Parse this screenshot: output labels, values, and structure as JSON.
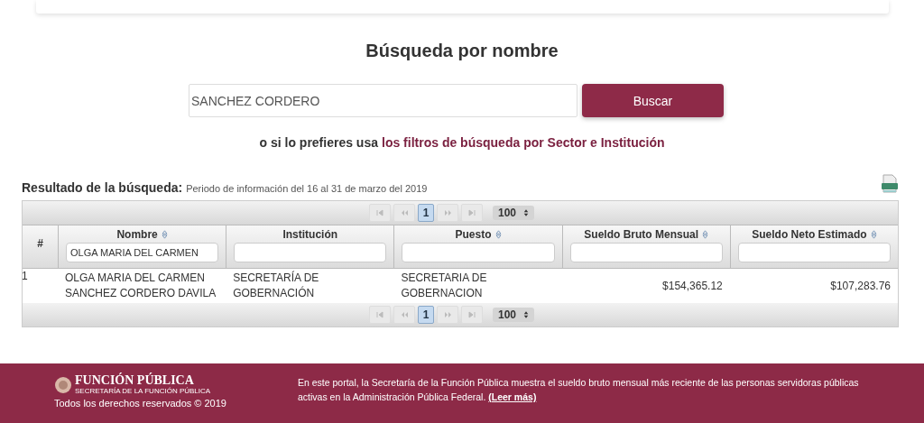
{
  "search": {
    "title": "Búsqueda por nombre",
    "value": "SANCHEZ CORDERO",
    "button": "Buscar",
    "alt_prefix": "o si lo prefieres usa",
    "alt_link": "los filtros de búsqueda por Sector e Institución"
  },
  "results": {
    "label": "Resultado de la búsqueda:",
    "period": "Periodo de información del 16 al 31 de marzo del 2019"
  },
  "table": {
    "pagers": [
      {
        "page": "1",
        "page_size": "100"
      },
      {
        "page": "1",
        "page_size": "100"
      }
    ],
    "index_header": "#",
    "columns": [
      {
        "label": "Nombre",
        "sortable": true,
        "filter": "OLGA MARIA DEL CARMEN"
      },
      {
        "label": "Institución",
        "sortable": false
      },
      {
        "label": "Puesto",
        "sortable": true
      },
      {
        "label": "Sueldo Bruto Mensual",
        "sortable": true
      },
      {
        "label": "Sueldo Neto Estimado",
        "sortable": true
      }
    ],
    "rows": [
      {
        "index": "1",
        "cells": [
          "OLGA MARIA DEL CARMEN SANCHEZ CORDERO DAVILA",
          "SECRETARÍA DE GOBERNACIÓN",
          "SECRETARIA DE GOBERNACION",
          "$154,365.12",
          "$107,283.76"
        ]
      }
    ]
  },
  "footer": {
    "logo": "FUNCIÓN PÚBLICA",
    "logo_subtitle": "SECRETARÍA DE LA FUNCIÓN PÚBLICA",
    "copyright": "Todos los derechos reservados © 2019",
    "description": "En este portal, la Secretaría de la Función Pública muestra el sueldo bruto mensual más reciente de las personas servidoras públicas activas en la Administración Pública Federal.",
    "more_link": "(Leer más)"
  }
}
